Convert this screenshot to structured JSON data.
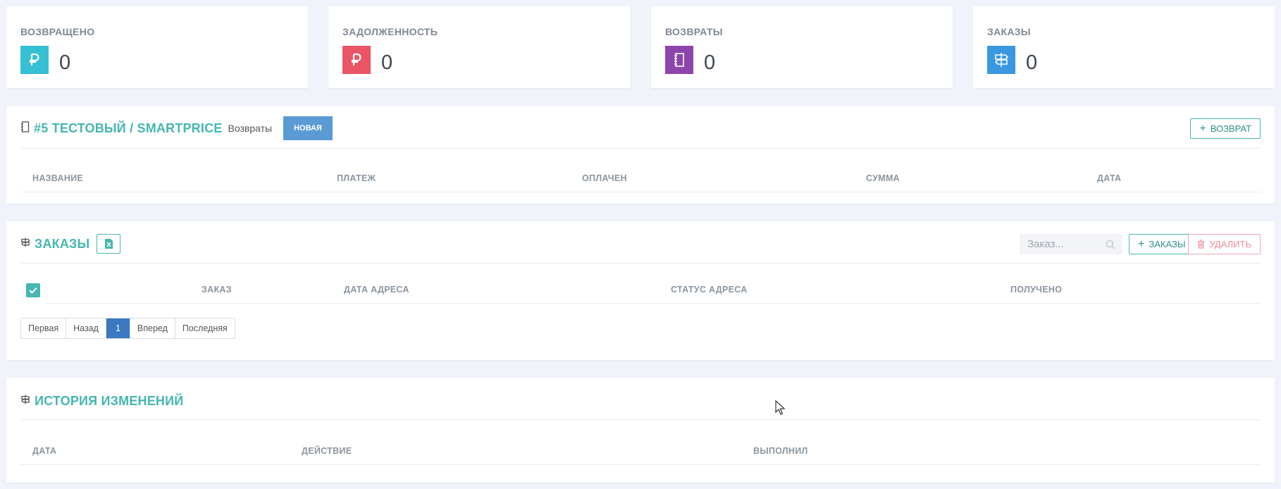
{
  "stats": [
    {
      "title": "ВОЗВРАЩЕНО",
      "value": "0",
      "icon": "ruble-icon",
      "color": "#35c0d3"
    },
    {
      "title": "ЗАДОЛЖЕННОСТЬ",
      "value": "0",
      "icon": "ruble-icon",
      "color": "#ea5565"
    },
    {
      "title": "ВОЗВРАТЫ",
      "value": "0",
      "icon": "notebook-icon",
      "color": "#8e44ad"
    },
    {
      "title": "ЗАКАЗЫ",
      "value": "0",
      "icon": "signpost-icon",
      "color": "#3a98e0"
    }
  ],
  "returns_panel": {
    "title": "#5 ТЕСТОВЫЙ / SMARTPRICE",
    "subtitle": "Возвраты",
    "status_badge": "НОВАЯ",
    "add_button": "ВОЗВРАТ",
    "columns": [
      "НАЗВАНИЕ",
      "ПЛАТЕЖ",
      "ОПЛАЧЕН",
      "СУММА",
      "ДАТА"
    ]
  },
  "orders_panel": {
    "title": "ЗАКАЗЫ",
    "search_placeholder": "Заказ...",
    "add_button": "ЗАКАЗЫ",
    "delete_button": "УДАЛИТЬ",
    "columns": [
      "ЗАКАЗ",
      "ДАТА АДРЕСА",
      "СТАТУС АДРЕСА",
      "ПОЛУЧЕНО"
    ],
    "pagination": {
      "first": "Первая",
      "prev": "Назад",
      "current": "1",
      "next": "Вперед",
      "last": "Последняя"
    }
  },
  "history_panel": {
    "title": "ИСТОРИЯ ИЗМЕНЕНИЙ",
    "columns": [
      "ДАТА",
      "ДЕЙСТВИЕ",
      "ВЫПОЛНИЛ"
    ]
  },
  "colors": {
    "accent": "#45b6b0",
    "primary": "#3a78c2",
    "badge": "#5b9bd5",
    "danger": "#f08a98"
  }
}
